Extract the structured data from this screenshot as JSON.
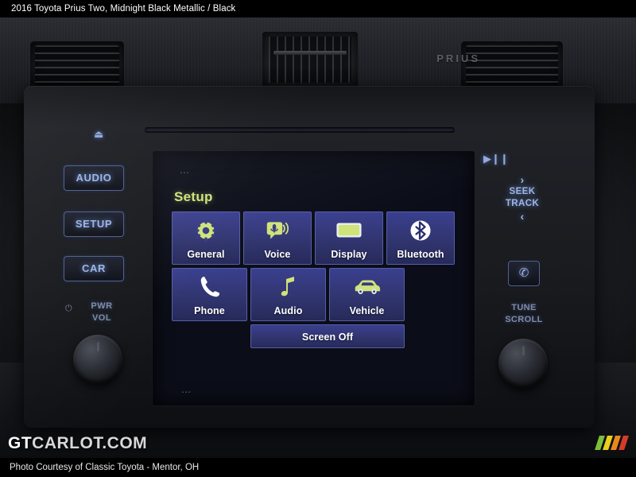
{
  "top_caption": {
    "title": "2016 Toyota Prius Two",
    "separator": ",",
    "colors": "Midnight Black Metallic / Black"
  },
  "bottom_caption": {
    "text": "Photo Courtesy of Classic Toyota - Mentor, OH"
  },
  "watermark": {
    "prefix": "GT",
    "suffix": "CARLOT.COM",
    "bar_colors": [
      "#7bbf3a",
      "#e8d01e",
      "#e8881e",
      "#d43b2a"
    ]
  },
  "dashboard": {
    "prius_badge": "PRIUS",
    "vent_left": "air-vent-left",
    "vent_right": "air-vent-right",
    "vent_center": "air-vent-center"
  },
  "head_unit": {
    "eject_icon": "⏏",
    "play_pause_icon": "▶❙❙",
    "left_buttons": [
      {
        "label": "AUDIO",
        "name": "audio-button"
      },
      {
        "label": "SETUP",
        "name": "setup-button"
      },
      {
        "label": "CAR",
        "name": "car-button"
      }
    ],
    "power_volume": {
      "line1": "PWR",
      "line2": "VOL",
      "mark": "⏻"
    },
    "seek_track": {
      "up_chevron": "›",
      "line1": "SEEK",
      "line2": "TRACK",
      "down_chevron": "‹"
    },
    "phone_button_icon": "✆",
    "tune_scroll": {
      "line1": "TUNE",
      "line2": "SCROLL"
    }
  },
  "screen": {
    "title": "Setup",
    "top_dots": "⋯",
    "bottom_dots": "⋯",
    "tiles": [
      {
        "label": "General",
        "icon": "gear-icon"
      },
      {
        "label": "Voice",
        "icon": "voice-command-icon"
      },
      {
        "label": "Display",
        "icon": "display-icon"
      },
      {
        "label": "Bluetooth",
        "icon": "bluetooth-icon"
      },
      {
        "label": "Phone",
        "icon": "phone-handset-icon"
      },
      {
        "label": "Audio",
        "icon": "music-note-icon"
      },
      {
        "label": "Vehicle",
        "icon": "car-icon"
      }
    ],
    "screen_off_label": "Screen Off",
    "tile_color": "#363b82",
    "accent_text_color": "#cfe37a"
  }
}
